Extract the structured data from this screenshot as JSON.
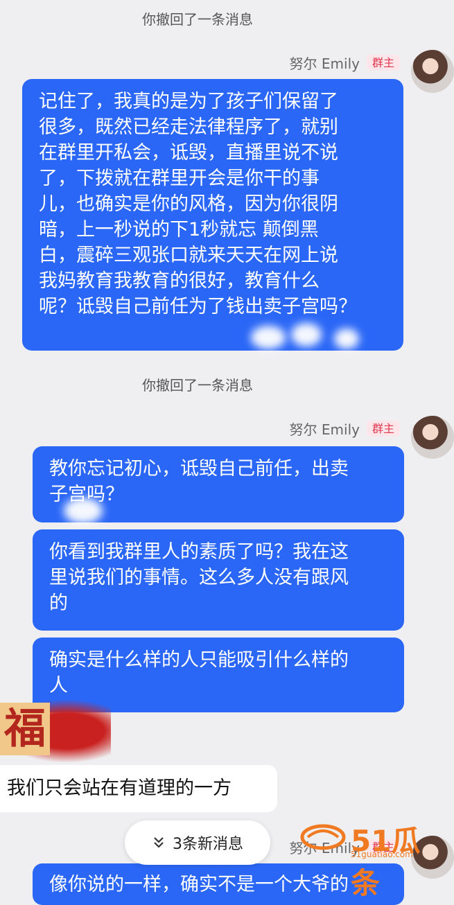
{
  "system": {
    "recall_1": "你撤回了一条消息",
    "recall_2": "你撤回了一条消息"
  },
  "sender": {
    "name": "努尔 Emily",
    "badge": "群主"
  },
  "messages": {
    "m1_lines": [
      "记住了，我真的是为了孩子们保留了",
      "很多，既然已经走法律程序了，就别",
      "在群里开私会，诋毁，直播里说不说",
      "了，下拨就在群里开会是你干的事",
      "儿，也确实是你的风格，因为你很阴",
      "暗，上一秒说的下1秒就忘 颠倒黑",
      "白，震碎三观张口就来天天在网上说",
      "我妈教育我教育的很好，教育什么",
      "呢？诋毁自己前任为了钱出卖子宫吗？"
    ],
    "m2_lines": [
      "教你忘记初心，诋毁自己前任，出卖",
      "子宫吗？"
    ],
    "m3_lines": [
      "你看到我群里人的素质了吗？我在这",
      "里说我们的事情。这么多人没有跟风",
      "的"
    ],
    "m4_lines": [
      "确实是什么样的人只能吸引什么样的",
      "人"
    ],
    "incoming": "我们只会站在有道理的一方",
    "last_partial": "像你说的一样，确实不是一个大爷的"
  },
  "deco": {
    "fu": "福"
  },
  "new_messages": {
    "icon": "double-chevron-down-icon",
    "label": "3条新消息"
  },
  "watermark": {
    "logo": "～",
    "text": "51瓜条",
    "url": "51guatiao.com"
  },
  "colors": {
    "bubble": "#2b67f6",
    "badge_text": "#e0364f",
    "background": "#efeff1"
  }
}
